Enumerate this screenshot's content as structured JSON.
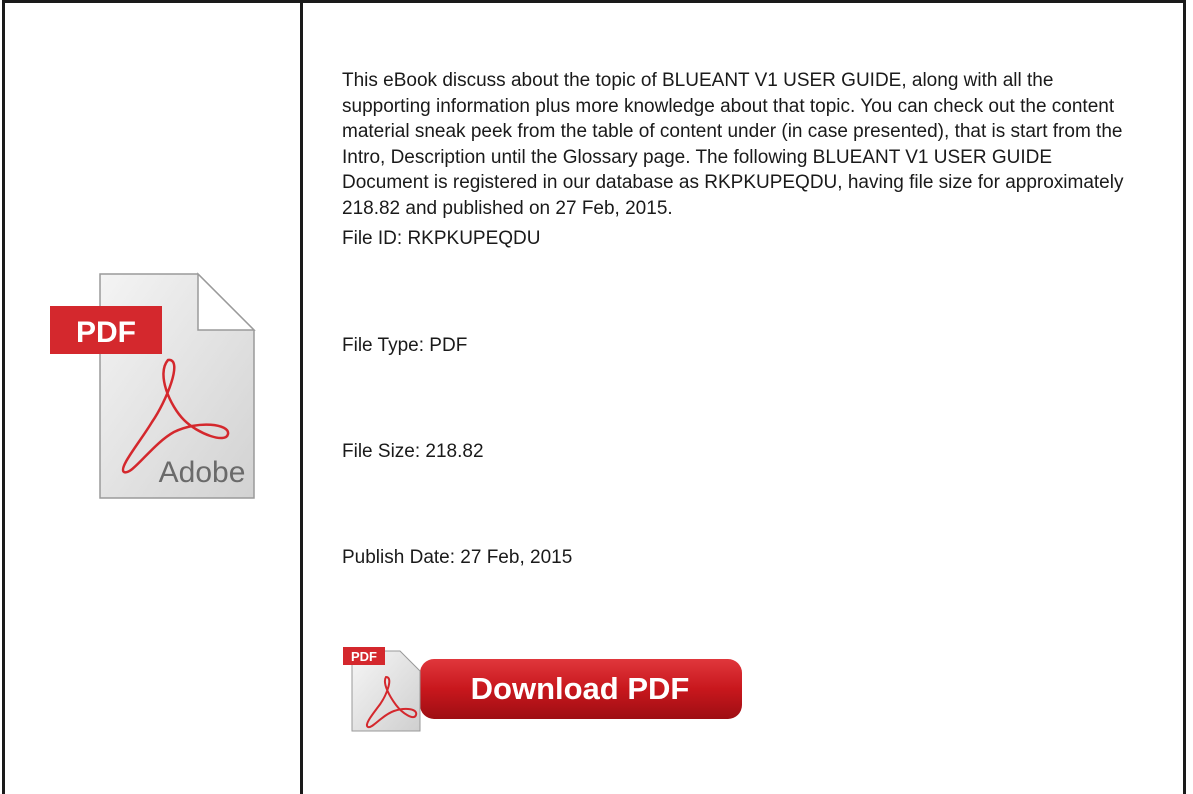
{
  "description": "This eBook discuss about the topic of BLUEANT V1 USER GUIDE, along with all the supporting information plus more knowledge about that topic. You can check out the content material sneak peek from the table of content under (in case presented), that is start from the Intro, Description until the Glossary page. The following BLUEANT V1 USER GUIDE Document is registered in our database as RKPKUPEQDU, having file size for approximately 218.82 and published on 27 Feb, 2015.",
  "file_id": "File ID: RKPKUPEQDU",
  "file_type": "File Type: PDF",
  "file_size": "File Size: 218.82",
  "publish_date": "Publish Date: 27 Feb, 2015",
  "pdf_icon": {
    "badge": "PDF",
    "brand": "Adobe",
    "badge_color": "#d4282d"
  },
  "download_button": {
    "label": "Download PDF",
    "badge": "PDF",
    "color": "#c8171d"
  }
}
